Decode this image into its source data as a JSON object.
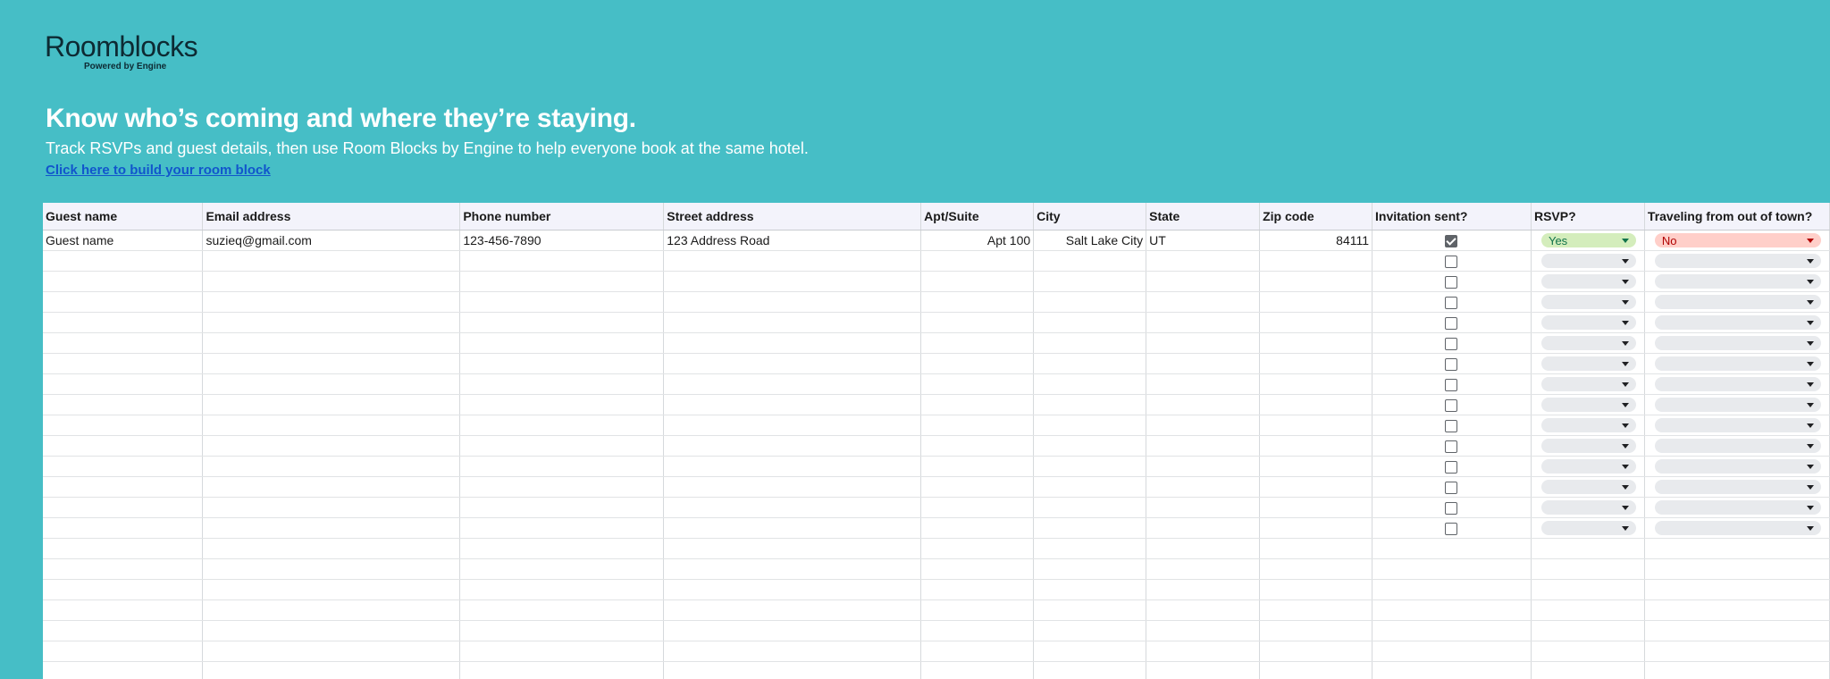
{
  "brand": {
    "name": "Roomblocks",
    "tagline": "Powered by Engine"
  },
  "hero": {
    "headline": "Know who’s coming and where they’re staying.",
    "subline": "Track RSVPs and guest details, then use Room Blocks by Engine to help everyone book at the same hotel.",
    "link": "Click here to build your room block"
  },
  "table": {
    "headers": [
      "Guest name",
      "Email address",
      "Phone number",
      "Street address",
      "Apt/Suite",
      "City",
      "State",
      "Zip code",
      "Invitation sent?",
      "RSVP?",
      "Traveling from out of town?"
    ],
    "first_row": {
      "guest_name": "Guest name",
      "email": "suzieq@gmail.com",
      "phone": "123-456-7890",
      "street": "123 Address Road",
      "apt": "Apt 100",
      "city": "Salt Lake City",
      "state": "UT",
      "zip": "84111",
      "invitation_sent": true,
      "rsvp": "Yes",
      "out_of_town": "No"
    },
    "empty_checkbox_rows": 14,
    "blank_rows": 7
  },
  "colors": {
    "background": "#46bec6",
    "header_bg": "#f3f3fb",
    "link": "#1155cc",
    "chip_yes": "#d4edbc",
    "chip_no": "#ffcfc9",
    "chip_empty": "#e8eaed"
  }
}
